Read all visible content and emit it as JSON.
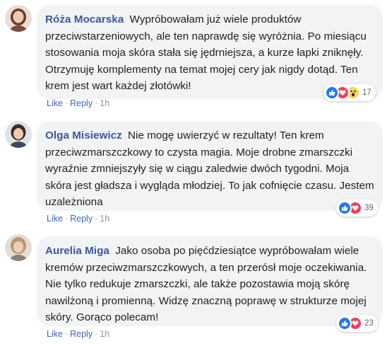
{
  "comments": [
    {
      "author": "Róża Mocarska",
      "text": "Wypróbowałam już wiele produktów przeciwstarzeniowych, ale ten naprawdę się wyróżnia. Po miesiącu stosowania moja skóra stała się jędrniejsza, a kurze łapki zniknęły. Otrzymuję komplementy na temat mojej cery jak nigdy dotąd. Ten krem jest wart każdej złotówki!",
      "reaction_count": "17",
      "like_label": "Like",
      "reply_label": "Reply",
      "time": "1h"
    },
    {
      "author": "Olga Misiewicz",
      "text": "Nie mogę uwierzyć w rezultaty! Ten krem przeciwzmarszczkowy to czysta magia. Moje drobne zmarszczki wyraźnie zmniejszyły się w ciągu zaledwie dwóch tygodni. Moja skóra jest gładsza i wygląda młodziej. To jak cofnięcie czasu. Jestem uzależniona",
      "reaction_count": "39",
      "like_label": "Like",
      "reply_label": "Reply",
      "time": "1h"
    },
    {
      "author": "Aurelia Miga",
      "text": "Jako osoba po pięćdziesiątce wypróbowałam wiele kremów przeciwzmarszczkowych, a ten przerósł moje oczekiwania. Nie tylko redukuje zmarszczki, ale także pozostawia moją skórę nawilżoną i promienną. Widzę znaczną poprawę w strukturze mojej skóry. Gorąco polecam!",
      "reaction_count": "23",
      "like_label": "Like",
      "reply_label": "Reply",
      "time": "1h"
    }
  ],
  "separator": "·",
  "reaction_icons": [
    "like-icon",
    "love-icon",
    "wow-icon"
  ],
  "colors": {
    "author": "#385898",
    "link": "#4267b2",
    "bubble": "#f2f3f5",
    "like": "#2078f4",
    "love": "#f33e58",
    "wow": "#fcd35c"
  }
}
